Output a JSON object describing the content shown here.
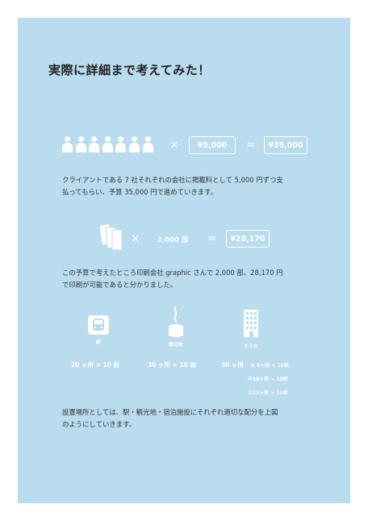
{
  "title": "実際に詳細まで考えてみた！",
  "row1": {
    "times": "×",
    "equals": "=",
    "unit_price": "¥5,000",
    "total": "¥35,000"
  },
  "para1": [
    "クライアントである 7 社それぞれの会社に掲載料として 5,000 円ずつ支",
    "払ってもらい、予算 35,000 円で進めていきます。"
  ],
  "row2": {
    "times": "×",
    "equals": "=",
    "copies": "2,000 部",
    "total": "¥28,170"
  },
  "para2": [
    "この予算で考えたところ印刷会社 graphic さんで 2,000 部、28,170 円",
    "で印刷が可能であると分かりました。"
  ],
  "icons": {
    "station": "駅",
    "sightseeing": "観光地",
    "hotel": "ホテル"
  },
  "stats": {
    "station": "20 ヶ所 × 10 枚",
    "sightseeing": "30 ヶ所 × 10 枚",
    "hotel_main": "30 ヶ所",
    "hotel_large": "大 5ヶ所 × 10枚",
    "hotel_medium": "中10ヶ所 × 10枚",
    "hotel_small": "小15ヶ所 × 10枚"
  },
  "para3": [
    "設置場所としては、駅・観光地・宿泊施設にそれぞれ適切な配分を上図",
    "のようにしていきます。"
  ]
}
